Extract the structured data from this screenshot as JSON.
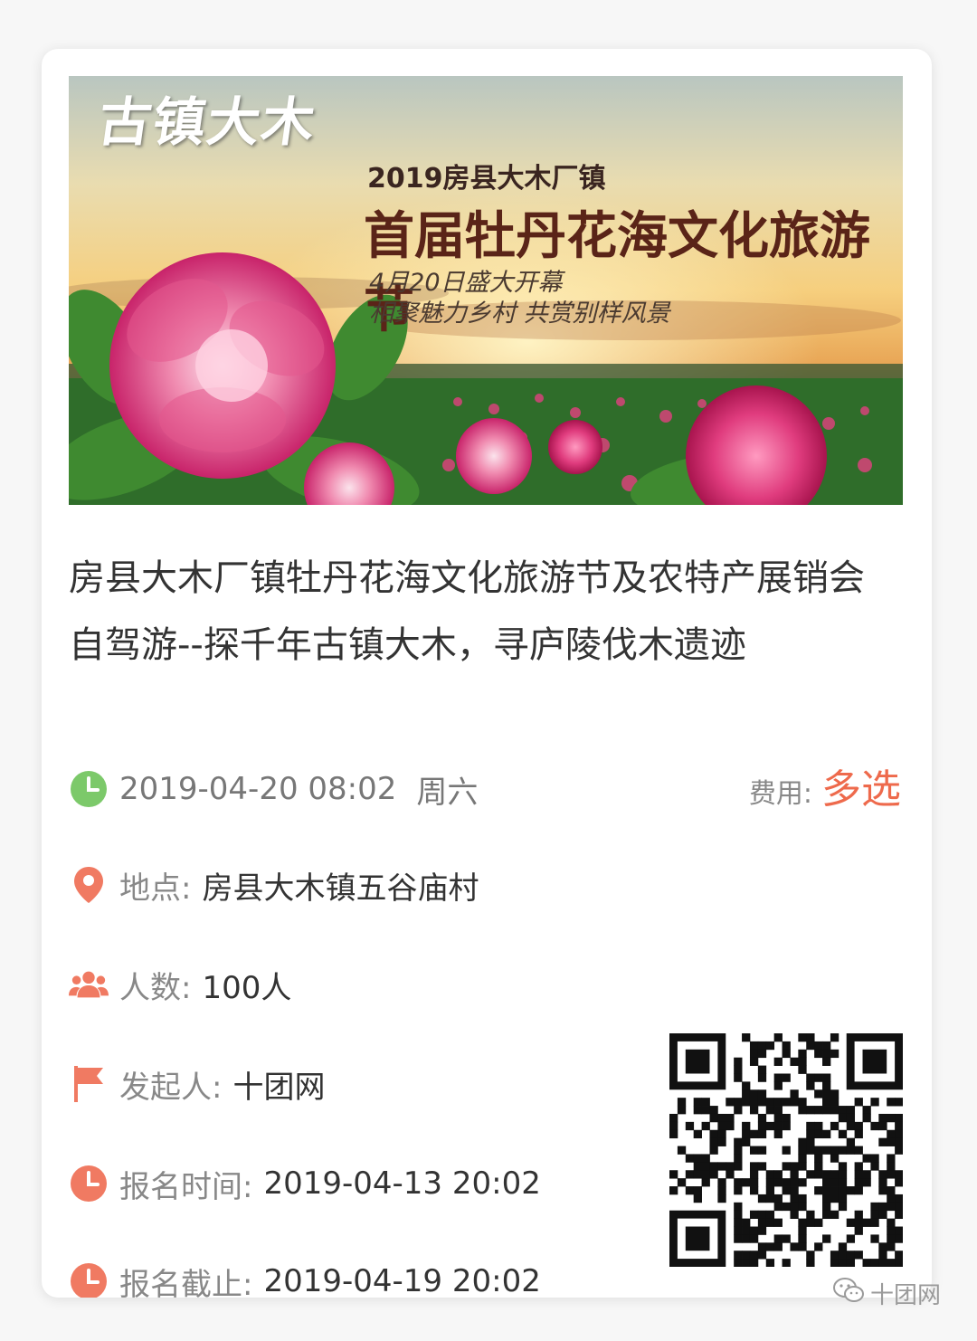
{
  "banner": {
    "brand": "古镇大木",
    "year_line": "2019房县大木厂镇",
    "festival": "首届牡丹花海文化旅游节",
    "line1": "4月20日盛大开幕",
    "line2": "相聚魅力乡村 共赏别样风景"
  },
  "event": {
    "title": "房县大木厂镇牡丹花海文化旅游节及农特产展销会自驾游--探千年古镇大木，寻庐陵伐木遗迹",
    "datetime": "2019-04-20 08:02",
    "weekday": "周六",
    "fee_label": "费用:",
    "fee_value": "多选",
    "location_label": "地点:",
    "location_value": "房县大木镇五谷庙村",
    "people_label": "人数:",
    "people_value": "100人",
    "organizer_label": "发起人:",
    "organizer_value": "十团网",
    "signup_start_label": "报名时间:",
    "signup_start_value": "2019-04-13 20:02",
    "signup_end_label": "报名截止:",
    "signup_end_value": "2019-04-19 20:02"
  },
  "watermark": {
    "text": "十团网"
  },
  "icons": {
    "datetime": "clock-icon",
    "location": "location-pin-icon",
    "people": "people-icon",
    "organizer": "flag-icon",
    "signup_start": "clock-icon",
    "signup_end": "clock-icon",
    "watermark": "wechat-icon"
  },
  "colors": {
    "accent": "#ee6a4c",
    "clock_green": "#7cc96a",
    "icon_red": "#f07a62"
  }
}
